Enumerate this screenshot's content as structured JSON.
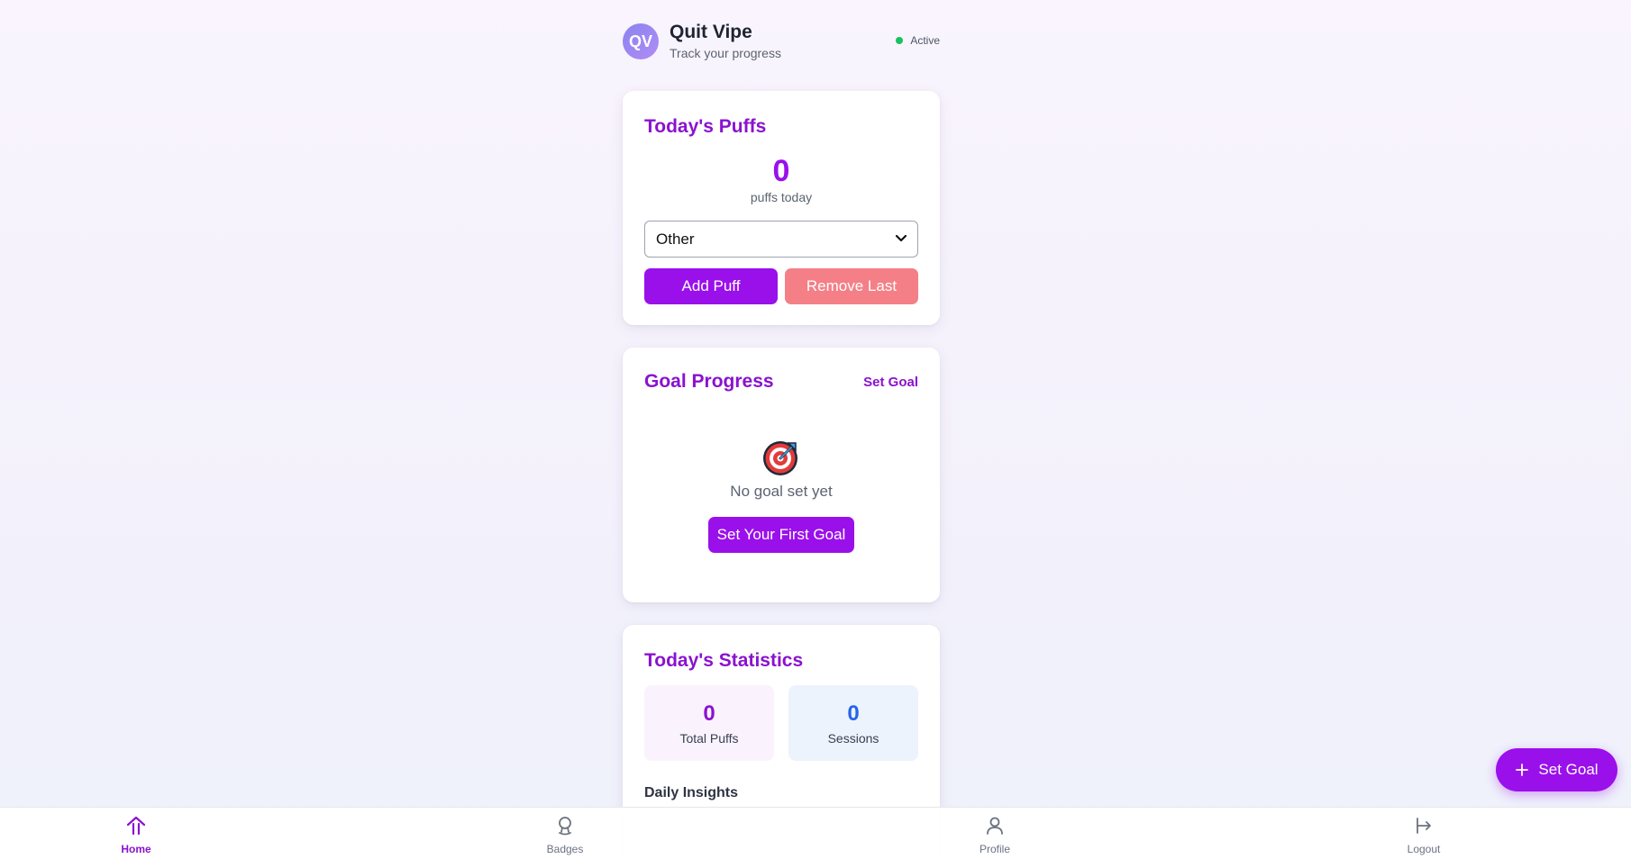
{
  "header": {
    "avatar_initials": "QV",
    "title": "Quit Vipe",
    "subtitle": "Track your progress",
    "status": "Active",
    "status_color": "#16c35c"
  },
  "puffs": {
    "title": "Today's Puffs",
    "count": "0",
    "count_label": "puffs today",
    "select_value": "Other",
    "add_label": "Add Puff",
    "remove_label": "Remove Last"
  },
  "goal": {
    "title": "Goal Progress",
    "set_goal_link": "Set Goal",
    "icon": "target-icon",
    "empty_text": "No goal set yet",
    "first_goal_label": "Set Your First Goal"
  },
  "stats": {
    "title": "Today's Statistics",
    "total_value": "0",
    "total_label": "Total Puffs",
    "sessions_value": "0",
    "sessions_label": "Sessions",
    "insights_title": "Daily Insights"
  },
  "nav": {
    "items": [
      {
        "label": "Home",
        "icon": "home-icon",
        "active": true
      },
      {
        "label": "Badges",
        "icon": "badge-icon",
        "active": false
      },
      {
        "label": "Profile",
        "icon": "profile-icon",
        "active": false
      },
      {
        "label": "Logout",
        "icon": "logout-icon",
        "active": false
      }
    ]
  },
  "fab": {
    "label": "Set Goal",
    "icon": "plus-icon"
  },
  "colors": {
    "accent": "#9a10ea",
    "title": "#8a12cf",
    "danger": "#f47f87",
    "sessions": "#2563eb"
  }
}
